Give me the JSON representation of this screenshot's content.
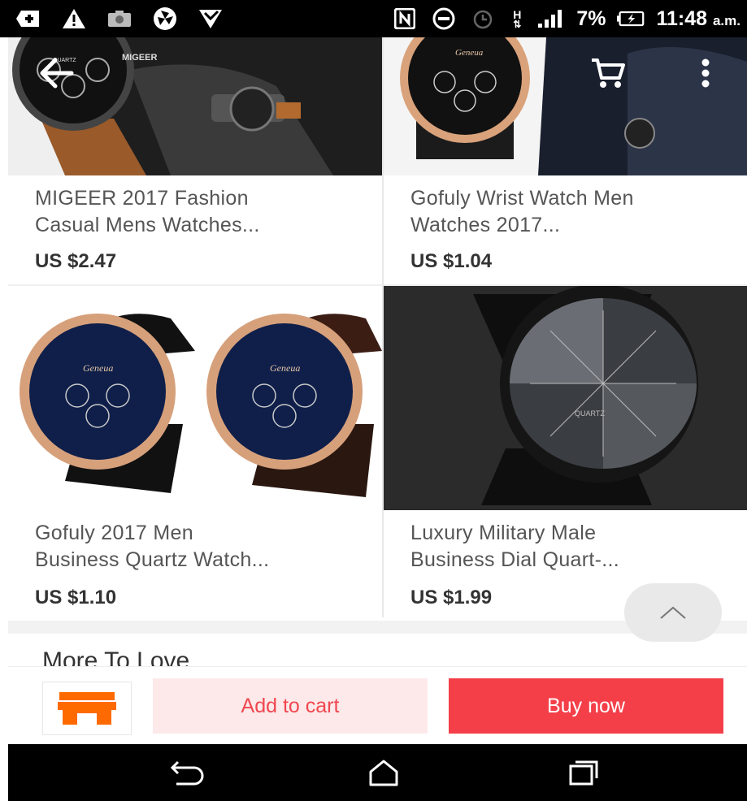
{
  "status_bar": {
    "icons": [
      "plus-box-icon",
      "warning-icon",
      "camera-icon",
      "pinwheel-icon",
      "shield-icon",
      "nfc-icon",
      "do-not-disturb-icon",
      "alarm-icon",
      "network-h-icon",
      "signal-icon",
      "battery-icon"
    ],
    "network_label": "H",
    "battery_percent": "7%",
    "time": "11:48",
    "ampm": "a.m."
  },
  "header": {
    "back_icon": "arrow-left-icon",
    "cart_icon": "cart-icon",
    "menu_icon": "more-vertical-icon"
  },
  "products": [
    {
      "title_line1": "MIGEER 2017 Fashion",
      "title_line2": "Casual Mens Watches...",
      "price": "US $2.47",
      "image_brand": "MIGEER",
      "image_text": "QUARTZ"
    },
    {
      "title_line1": "Gofuly Wrist Watch Men",
      "title_line2": "Watches 2017...",
      "price": "US $1.04",
      "image_brand": "Geneua"
    },
    {
      "title_line1": "Gofuly 2017 Men",
      "title_line2": "Business Quartz Watch...",
      "price": "US $1.10",
      "image_brand": "Geneua"
    },
    {
      "title_line1": "Luxury Military Male",
      "title_line2": "Business Dial Quart-...",
      "price": "US $1.99",
      "image_text": "QUARTZ"
    }
  ],
  "section": {
    "more_to_love": "More To Love"
  },
  "actions": {
    "store_icon": "store-icon",
    "add_to_cart": "Add to cart",
    "buy_now": "Buy now"
  },
  "nav": {
    "back": "back-icon",
    "home": "home-icon",
    "recents": "recents-icon"
  },
  "colors": {
    "accent": "#f43f49",
    "cart_bg": "#fde9ea",
    "cart_text": "#f0474f",
    "store_orange": "#ff6a00"
  }
}
